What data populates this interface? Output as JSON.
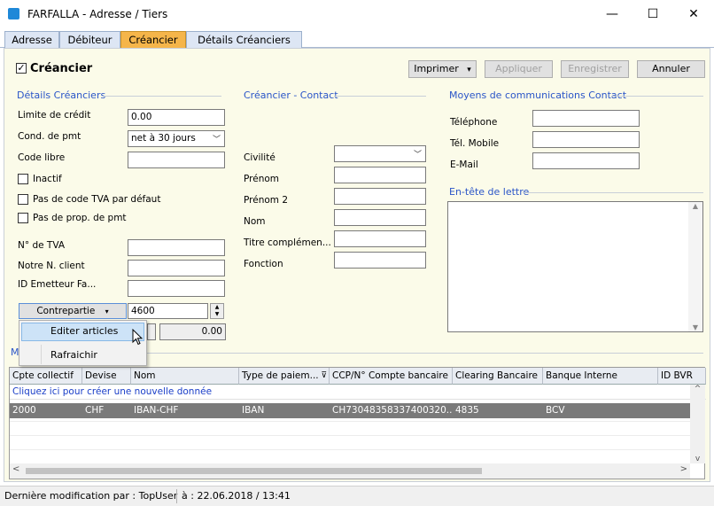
{
  "window": {
    "title": "FARFALLA - Adresse / Tiers",
    "minimize": "—",
    "maximize": "☐",
    "close": "✕"
  },
  "tabs": [
    {
      "label": "Adresse"
    },
    {
      "label": "Débiteur"
    },
    {
      "label": "Créancier"
    },
    {
      "label": "Détails Créanciers"
    }
  ],
  "header": {
    "checkbox_label": "Créancier",
    "checked_mark": "✓"
  },
  "toolbar": {
    "print": "Imprimer",
    "apply": "Appliquer",
    "save": "Enregistrer",
    "cancel": "Annuler",
    "print_arrow": "▾"
  },
  "details": {
    "title": "Détails Créanciers",
    "credit_limit_label": "Limite de crédit",
    "credit_limit_value": "0.00",
    "payment_cond_label": "Cond. de pmt",
    "payment_cond_value": "net à 30 jours",
    "free_code_label": "Code libre",
    "inactive_label": "Inactif",
    "no_vat_label": "Pas de code TVA par défaut",
    "no_payment_prop_label": "Pas de prop. de pmt",
    "vat_no_label": "N° de TVA",
    "client_no_label": "Notre N. client",
    "issuer_id_label": "ID Emetteur Fa...",
    "contrepartie_label": "Contrepartie",
    "contrepartie_value": "4600",
    "amount_value": "0.00"
  },
  "contact": {
    "title": "Créancier - Contact",
    "civility_label": "Civilité",
    "firstname_label": "Prénom",
    "firstname2_label": "Prénom 2",
    "name_label": "Nom",
    "title_label": "Titre complémen...",
    "function_label": "Fonction"
  },
  "comms": {
    "title": "Moyens de communications Contact",
    "phone_label": "Téléphone",
    "mobile_label": "Tél. Mobile",
    "email_label": "E-Mail",
    "letterhead_title": "En-tête de lettre"
  },
  "context_menu": {
    "items": [
      "Editer articles",
      "Rafraichir"
    ]
  },
  "section_partial": "M",
  "grid": {
    "columns": [
      "Cpte collectif",
      "Devise",
      "Nom",
      "Type de paiem...",
      "CCP/N° Compte bancaire",
      "Clearing Bancaire",
      "Banque Interne",
      "ID BVR"
    ],
    "new_row_text": "Cliquez ici pour créer une nouvelle donnée",
    "rows": [
      [
        "2000",
        "CHF",
        "IBAN-CHF",
        "IBAN",
        "CH73048358337400320...",
        "4835",
        "BCV",
        ""
      ]
    ],
    "scroll_left": "<",
    "scroll_right": ">",
    "scroll_up": "^",
    "scroll_down": "v",
    "filter_icon": "⊽"
  },
  "status": {
    "last_modified": "Dernière modification par : TopUser",
    "date": "à : 22.06.2018 / 13:41"
  }
}
